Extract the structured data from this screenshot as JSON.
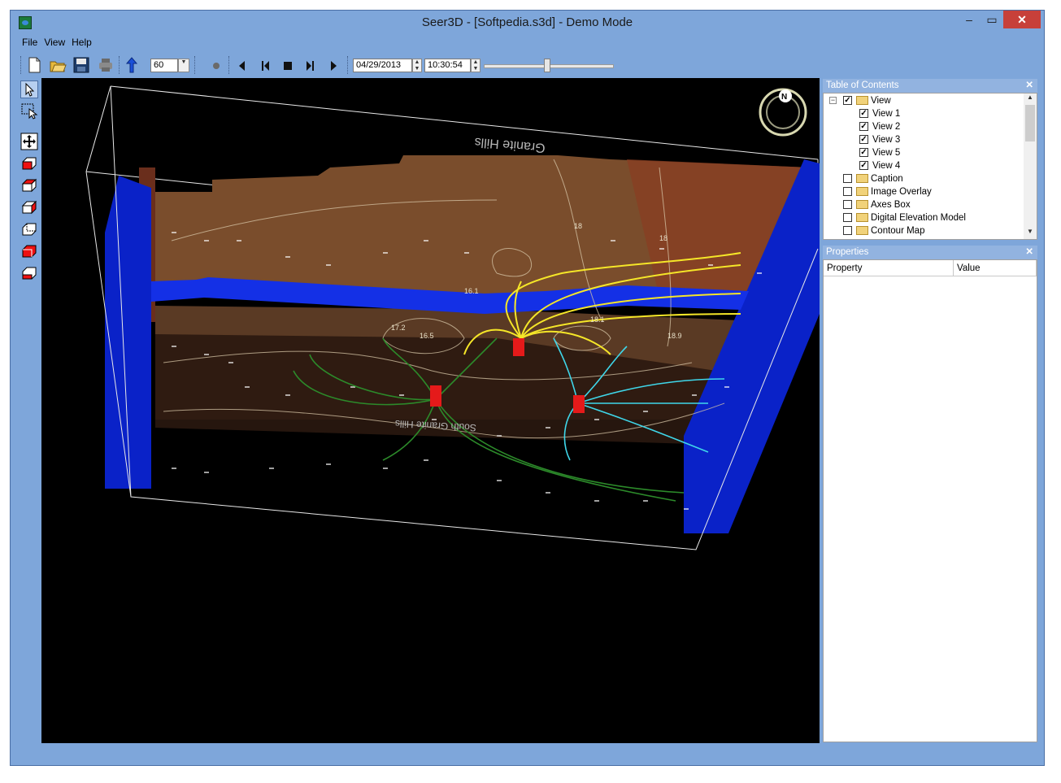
{
  "window": {
    "title": "Seer3D - [Softpedia.s3d] - Demo Mode",
    "min_label": "–",
    "max_label": "▭",
    "close_label": "✕"
  },
  "menu": {
    "file": "File",
    "view": "View",
    "help": "Help"
  },
  "toolbar": {
    "vertical_exag": "60",
    "date": "04/29/2013",
    "time": "10:30:54",
    "time_slider_position": 0.47
  },
  "viewport": {
    "label_top": "Granite Hills",
    "label_bottom": "South Granite Hills",
    "contour_labels": [
      "18",
      "18",
      "16.5",
      "17.2",
      "18.1",
      "18.9",
      "16.1"
    ],
    "compass_label": "N",
    "well_colors": {
      "yellow": "#f5e628",
      "cyan": "#3fd7ea",
      "green": "#2c8a2a",
      "well": "#e51a1a",
      "boundary": "#0a2ad8"
    }
  },
  "toc": {
    "title": "Table of Contents",
    "items": [
      {
        "label": "View",
        "checked": true,
        "folder": true,
        "level": 0,
        "expander": "−"
      },
      {
        "label": "View 1",
        "checked": true,
        "folder": false,
        "level": 1
      },
      {
        "label": "View 2",
        "checked": true,
        "folder": false,
        "level": 1
      },
      {
        "label": "View 3",
        "checked": true,
        "folder": false,
        "level": 1
      },
      {
        "label": "View 5",
        "checked": true,
        "folder": false,
        "level": 1
      },
      {
        "label": "View 4",
        "checked": true,
        "folder": false,
        "level": 1
      },
      {
        "label": "Caption",
        "checked": false,
        "folder": true,
        "level": 0
      },
      {
        "label": "Image Overlay",
        "checked": false,
        "folder": true,
        "level": 0
      },
      {
        "label": "Axes Box",
        "checked": false,
        "folder": true,
        "level": 0
      },
      {
        "label": "Digital Elevation Model",
        "checked": false,
        "folder": true,
        "level": 0
      },
      {
        "label": "Contour Map",
        "checked": false,
        "folder": true,
        "level": 0
      }
    ]
  },
  "properties": {
    "title": "Properties",
    "col_property": "Property",
    "col_value": "Value"
  }
}
